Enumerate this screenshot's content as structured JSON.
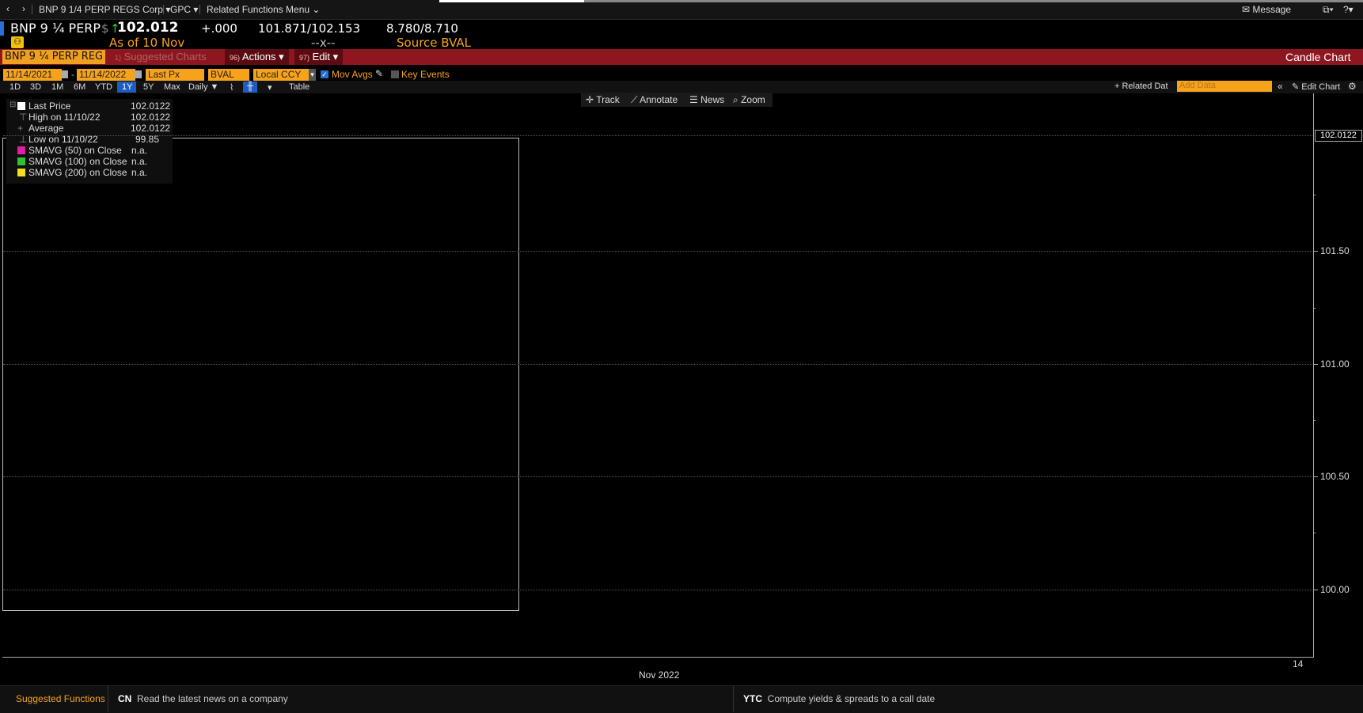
{
  "topbar": {
    "security": "BNP 9 1/4 PERP REGS Corp",
    "security_caret": "▾",
    "gpc": "GPC",
    "gpc_caret": "▾",
    "related": "Related Functions Menu",
    "message": "Message"
  },
  "quote": {
    "name": "BNP 9 ¼ PERP",
    "currency": "$",
    "arrow": "↑",
    "price": "102.012",
    "change": "+.000",
    "bid_ask": "101.871/102.153",
    "yields": "8.780/8.710",
    "as_of": "As of 10 Nov",
    "size": "--x--",
    "source": "Source BVAL"
  },
  "function_bar": {
    "tab_name": "BNP 9 ¼ PERP REG",
    "suggested": "Suggested Charts",
    "actions_num": "96)",
    "actions": "Actions",
    "edit_num": "97)",
    "edit": "Edit",
    "title": "Candle Chart"
  },
  "options": {
    "start_date": "11/14/2021",
    "end_date": "11/14/2022",
    "field": "Last Px",
    "source": "BVAL",
    "currency": "Local CCY",
    "mov_avgs": "Mov Avgs",
    "key_events": "Key Events",
    "related_data": "Related Dat",
    "add_data_placeholder": "Add Data",
    "edit_chart": "Edit Chart"
  },
  "periods": [
    "1D",
    "3D",
    "1M",
    "6M",
    "YTD",
    "1Y",
    "5Y",
    "Max"
  ],
  "selected_period": "1Y",
  "frequency": "Daily",
  "table_label": "Table",
  "chart_tools": {
    "track": "Track",
    "annotate": "Annotate",
    "news": "News",
    "zoom": "Zoom"
  },
  "legend": {
    "rows": [
      {
        "label": "Last Price",
        "value": "102.0122",
        "color": "#ffffff"
      },
      {
        "label": "High on 11/10/22",
        "value": "102.0122"
      },
      {
        "label": "Average",
        "value": "102.0122"
      },
      {
        "label": "Low on 11/10/22",
        "value": "99.85"
      },
      {
        "label": "SMAVG (50)  on Close",
        "value": "n.a.",
        "color": "#e020a0"
      },
      {
        "label": "SMAVG (100)  on Close",
        "value": "n.a.",
        "color": "#30c030"
      },
      {
        "label": "SMAVG (200)  on Close",
        "value": "n.a.",
        "color": "#f0e020"
      }
    ]
  },
  "chart_data": {
    "type": "line",
    "title": "",
    "x_label": "Nov 2022",
    "x_ticks": [
      "14"
    ],
    "ylim": [
      99.7,
      102.2
    ],
    "y_ticks": [
      "100.00",
      "100.50",
      "101.00",
      "101.50"
    ],
    "y_tick_values": [
      100.0,
      100.5,
      101.0,
      101.5
    ],
    "last_value": "102.0122",
    "last_value_num": 102.0122,
    "series": []
  },
  "bottom": {
    "suggested": "Suggested Functions",
    "cn_code": "CN",
    "cn_text": "Read the latest news on a company",
    "ytc_code": "YTC",
    "ytc_text": "Compute yields & spreads to a call date"
  },
  "colors": {
    "accent": "#f7a21b",
    "red_bar": "#8e1620",
    "selected": "#1d5cc0"
  }
}
